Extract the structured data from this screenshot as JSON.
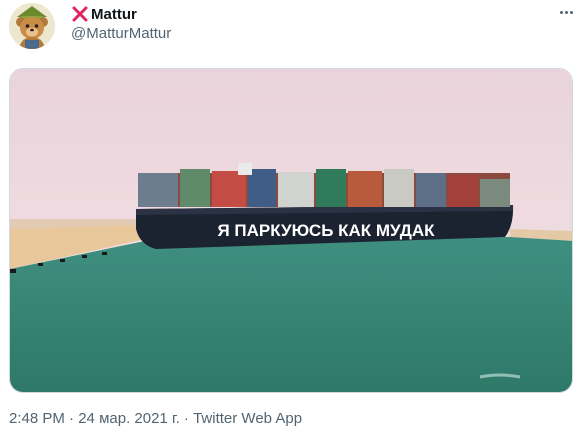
{
  "author": {
    "display_name": "Mattur",
    "handle": "@MatturMattur",
    "avatar_icon": "cartoon-bear-avatar-icon",
    "badge_icon": "red-x-icon"
  },
  "more_icon": "more-options-icon",
  "media": {
    "ship_text": "Я ПАРКУЮСЬ КАК МУДАК"
  },
  "meta": {
    "time": "2:48 PM",
    "separator": " · ",
    "date": "24 мар. 2021 г.",
    "source": "Twitter Web App"
  },
  "colors": {
    "text_primary": "#0f1419",
    "text_secondary": "#536471",
    "badge_red": "#e0245e"
  }
}
